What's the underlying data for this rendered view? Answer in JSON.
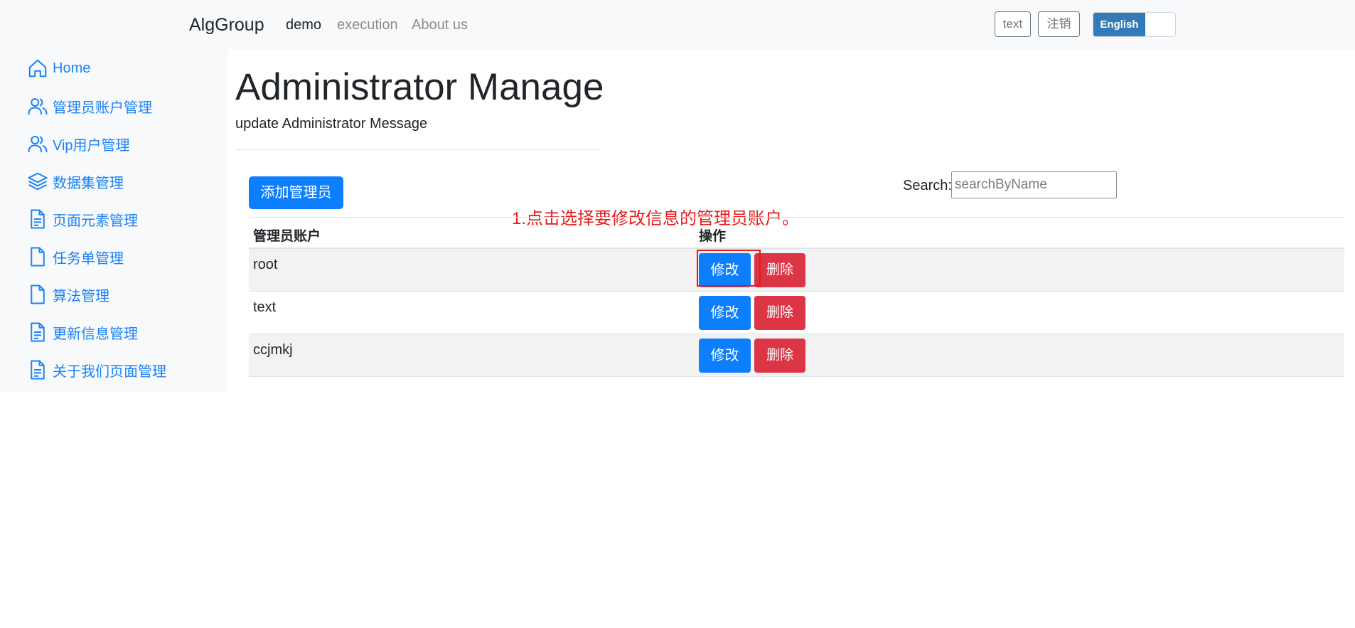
{
  "navbar": {
    "brand": "AlgGroup",
    "links": [
      "demo",
      "execution",
      "About us"
    ],
    "user_button": "text",
    "logout_button": "注销",
    "language_label": "English"
  },
  "sidebar": {
    "items": [
      {
        "label": "Home",
        "icon": "home-icon"
      },
      {
        "label": "管理员账户管理",
        "icon": "users-icon"
      },
      {
        "label": "Vip用户管理",
        "icon": "users-icon"
      },
      {
        "label": "数据集管理",
        "icon": "layers-icon"
      },
      {
        "label": "页面元素管理",
        "icon": "document-icon"
      },
      {
        "label": "任务单管理",
        "icon": "file-icon"
      },
      {
        "label": "算法管理",
        "icon": "file-icon"
      },
      {
        "label": "更新信息管理",
        "icon": "document-icon"
      },
      {
        "label": "关于我们页面管理",
        "icon": "document-icon"
      }
    ]
  },
  "main": {
    "title": "Administrator Manage",
    "subtitle": "update Administrator Message",
    "add_button": "添加管理员",
    "search_label": "Search:",
    "search_placeholder": "searchByName",
    "annotation": "1.点击选择要修改信息的管理员账户。",
    "table": {
      "headers": [
        "管理员账户",
        "操作"
      ],
      "rows": [
        {
          "name": "root",
          "edit": "修改",
          "delete": "删除"
        },
        {
          "name": "text",
          "edit": "修改",
          "delete": "删除"
        },
        {
          "name": "ccjmkj",
          "edit": "修改",
          "delete": "删除"
        }
      ]
    }
  },
  "colors": {
    "primary": "#0d7efc",
    "danger": "#dc3545",
    "sidebar_link": "#1a82f7",
    "annotation": "#e41a1a"
  }
}
